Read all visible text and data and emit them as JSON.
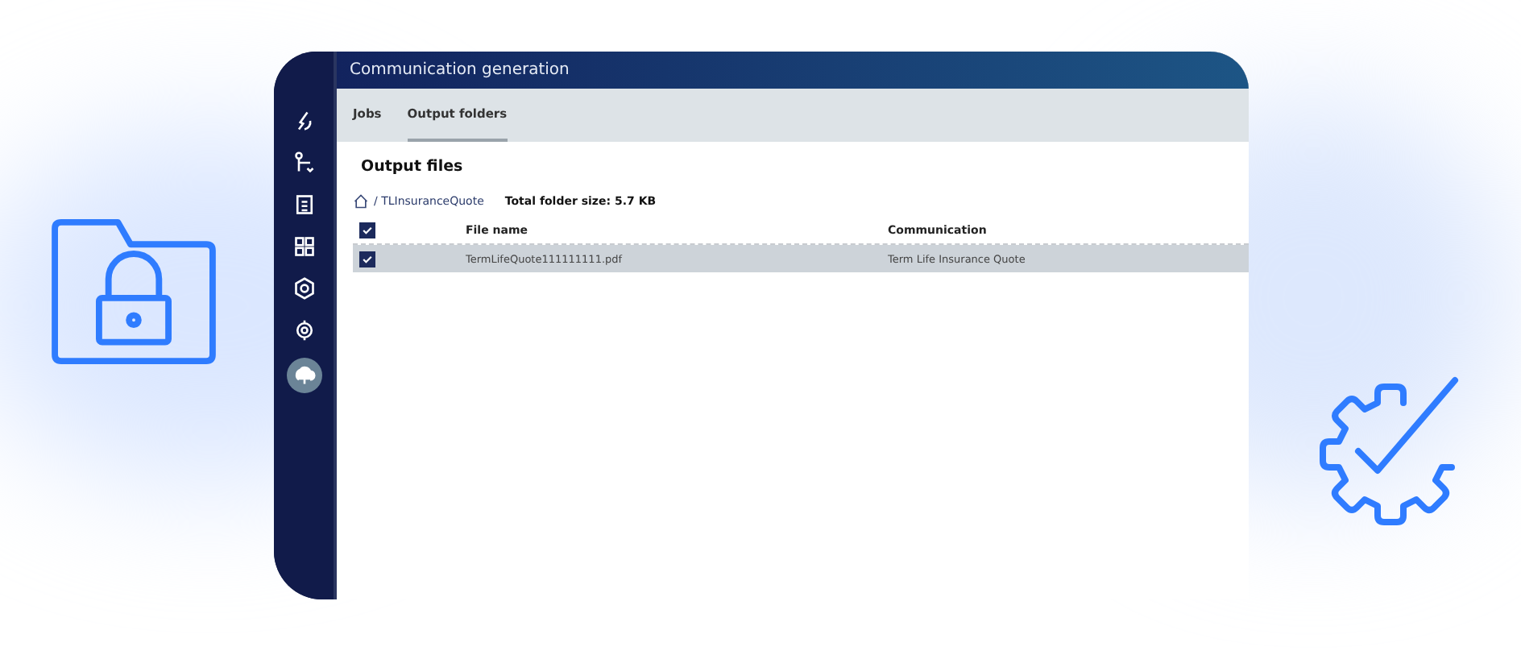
{
  "window": {
    "title": "Communication generation"
  },
  "sidebar": {
    "items": [
      {
        "kind": "pen",
        "selected": false
      },
      {
        "kind": "tree",
        "selected": false
      },
      {
        "kind": "document",
        "selected": false
      },
      {
        "kind": "grid",
        "selected": false
      },
      {
        "kind": "hexagon",
        "selected": false
      },
      {
        "kind": "target",
        "selected": false
      },
      {
        "kind": "upload",
        "selected": true
      }
    ]
  },
  "tabs": [
    {
      "label": "Jobs",
      "selected": false
    },
    {
      "label": "Output folders",
      "selected": true
    }
  ],
  "heading": "Output files",
  "breadcrumb": "/ TLInsuranceQuote",
  "folder_size": "Total folder size: 5.7 KB",
  "table": {
    "all_checked": true,
    "columns": [
      "File name",
      "Communication"
    ],
    "rows": [
      {
        "cells": [
          "TermLifeQuote111111111.pdf",
          "Term Life Insurance Quote"
        ],
        "checked": true,
        "selected": true
      }
    ]
  }
}
